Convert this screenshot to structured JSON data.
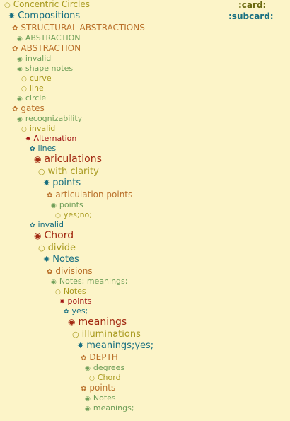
{
  "header": {
    "card_label": ":card:",
    "subcard_label": ":subcard:"
  },
  "colors": {
    "background": "#fcf4c8",
    "olive": "#a89a1f",
    "teal": "#186f80",
    "orange": "#b9702a",
    "green": "#6f9e58",
    "red": "#a22a12",
    "darkred": "#a11313",
    "header": "#6b6a10",
    "header_sub": "#186f80"
  },
  "outline": [
    {
      "bullet": "○",
      "text": "Concentric Circles",
      "style": "olive"
    },
    {
      "bullet": "✸",
      "text": "Compositions",
      "style": "teal"
    },
    {
      "bullet": "✿",
      "text": "STRUCTURAL ABSTRACTIONS",
      "style": "orange"
    },
    {
      "bullet": "◉",
      "text": "ABSTRACTION",
      "style": "green"
    },
    {
      "bullet": "✿",
      "text": "ABSTRACTION",
      "style": "orange"
    },
    {
      "bullet": "◉",
      "text": "invalid",
      "style": "green"
    },
    {
      "bullet": "◉",
      "text": "shape notes",
      "style": "green"
    },
    {
      "bullet": "○",
      "text": "curve",
      "style": "olive"
    },
    {
      "bullet": "○",
      "text": "line",
      "style": "olive"
    },
    {
      "bullet": "◉",
      "text": "circle",
      "style": "green"
    },
    {
      "bullet": "✿",
      "text": "gates",
      "style": "orange"
    },
    {
      "bullet": "◉",
      "text": "recognizability",
      "style": "green"
    },
    {
      "bullet": "○",
      "text": "invalid",
      "style": "olive"
    },
    {
      "bullet": "✸",
      "text": "Alternation",
      "style": "darkred"
    },
    {
      "bullet": "✿",
      "text": "lines",
      "style": "teal"
    },
    {
      "bullet": "◉",
      "text": "ariculations",
      "style": "red"
    },
    {
      "bullet": "○",
      "text": "with clarity",
      "style": "olive"
    },
    {
      "bullet": "✸",
      "text": "points",
      "style": "teal"
    },
    {
      "bullet": "✿",
      "text": "articulation points",
      "style": "orange"
    },
    {
      "bullet": "◉",
      "text": "points",
      "style": "green"
    },
    {
      "bullet": "○",
      "text": "yes;no;",
      "style": "olive"
    },
    {
      "bullet": "✿",
      "text": "invalid",
      "style": "teal"
    },
    {
      "bullet": "◉",
      "text": "Chord",
      "style": "red"
    },
    {
      "bullet": "○",
      "text": "divide",
      "style": "olive"
    },
    {
      "bullet": "✸",
      "text": "Notes",
      "style": "teal"
    },
    {
      "bullet": "✿",
      "text": "divisions",
      "style": "orange"
    },
    {
      "bullet": "◉",
      "text": "Notes; meanings;",
      "style": "green"
    },
    {
      "bullet": "○",
      "text": "Notes",
      "style": "olive"
    },
    {
      "bullet": "✸",
      "text": "points",
      "style": "darkred"
    },
    {
      "bullet": "✿",
      "text": "yes;",
      "style": "teal"
    },
    {
      "bullet": "◉",
      "text": "meanings",
      "style": "red"
    },
    {
      "bullet": "○",
      "text": "illuminations",
      "style": "olive"
    },
    {
      "bullet": "✸",
      "text": "meanings;yes;",
      "style": "teal"
    },
    {
      "bullet": "✿",
      "text": "DEPTH",
      "style": "orange"
    },
    {
      "bullet": "◉",
      "text": "degrees",
      "style": "green"
    },
    {
      "bullet": "○",
      "text": "Chord",
      "style": "olive"
    },
    {
      "bullet": "✿",
      "text": "points",
      "style": "orange"
    },
    {
      "bullet": "◉",
      "text": "Notes",
      "style": "green"
    },
    {
      "bullet": "◉",
      "text": "meanings;",
      "style": "green"
    }
  ]
}
